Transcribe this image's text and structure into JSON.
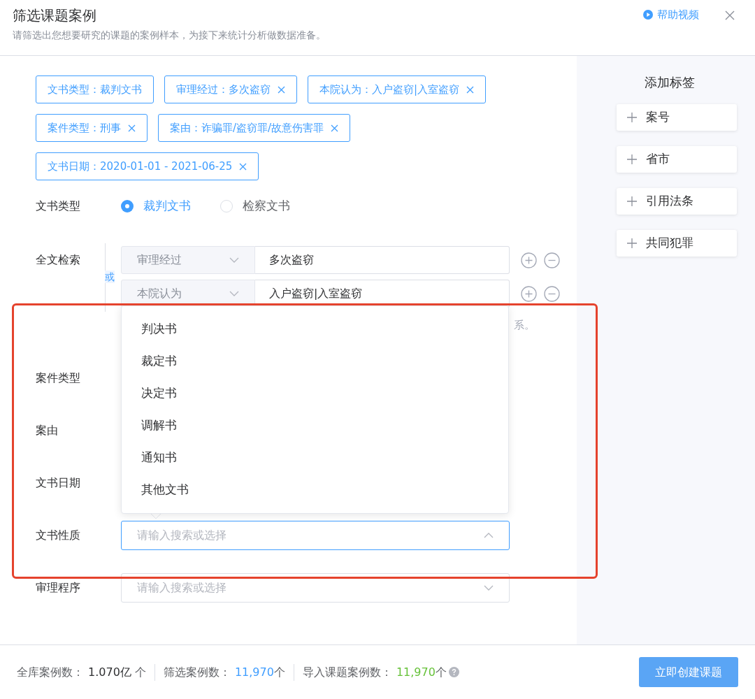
{
  "header": {
    "title": "筛选课题案例",
    "subtitle": "请筛选出您想要研究的课题的案例样本，为接下来统计分析做数据准备。",
    "help_link": "帮助视频"
  },
  "filter_tags": [
    {
      "text": "文书类型：裁判文书",
      "removable": false
    },
    {
      "text": "审理经过：多次盗窃",
      "removable": true
    },
    {
      "text": "本院认为：入户盗窃|入室盗窃",
      "removable": true
    },
    {
      "text": "案件类型：刑事",
      "removable": true
    },
    {
      "text": "案由：诈骗罪/盗窃罪/故意伤害罪",
      "removable": true
    },
    {
      "text": "文书日期：2020-01-01 - 2021-06-25",
      "removable": true
    }
  ],
  "doc_type": {
    "label": "文书类型",
    "options": [
      {
        "label": "裁判文书",
        "selected": true
      },
      {
        "label": "检察文书",
        "selected": false
      }
    ]
  },
  "fulltext": {
    "label": "全文检索",
    "connector": "或",
    "conditions": [
      {
        "field": "审理经过",
        "value": "多次盗窃"
      },
      {
        "field": "本院认为",
        "value": "入户盗窃|入室盗窃"
      }
    ],
    "hint": "系。"
  },
  "fields": [
    {
      "label": "案件类型"
    },
    {
      "label": "案由"
    },
    {
      "label": "文书日期"
    },
    {
      "label": "文书性质",
      "placeholder": "请输入搜索或选择",
      "open": true
    },
    {
      "label": "审理程序",
      "placeholder": "请输入搜索或选择",
      "open": false
    }
  ],
  "dropdown": {
    "options": [
      "判决书",
      "裁定书",
      "决定书",
      "调解书",
      "通知书",
      "其他文书"
    ]
  },
  "sidebar": {
    "title": "添加标签",
    "buttons": [
      "案号",
      "省市",
      "引用法条",
      "共同犯罪"
    ]
  },
  "footer": {
    "stats": [
      {
        "label": "全库案例数：",
        "value": "1.070亿",
        "unit": " 个",
        "color": "#303133"
      },
      {
        "label": "筛选案例数：",
        "value": "11,970",
        "unit": "个",
        "color": "#409eff"
      },
      {
        "label": "导入课题案例数：",
        "value": "11,970",
        "unit": "个",
        "color": "#67c23a"
      }
    ],
    "button": "立即创建课题"
  }
}
